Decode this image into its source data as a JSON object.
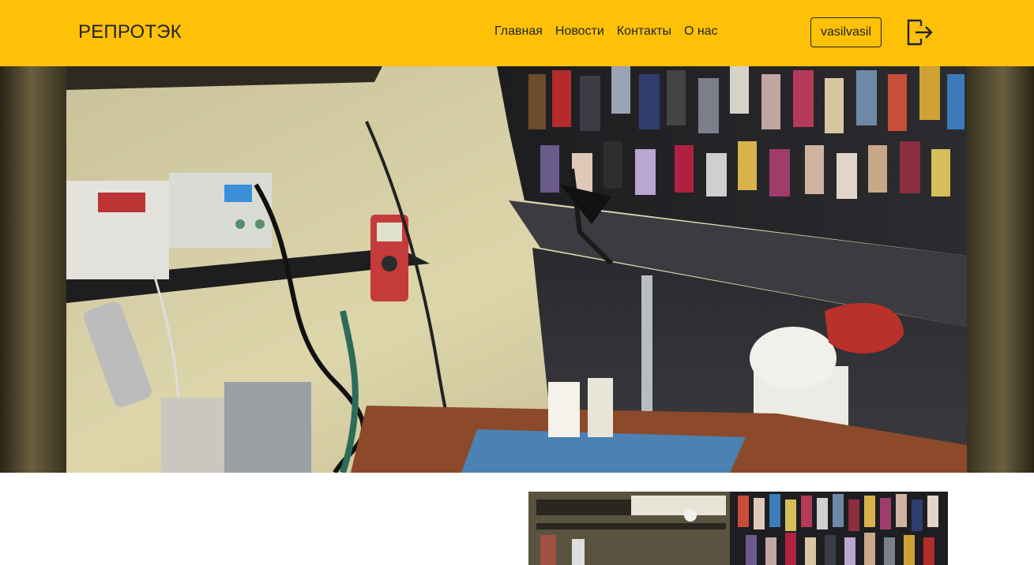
{
  "header": {
    "brand": "РЕПРОТЭК",
    "nav": [
      {
        "label": "Главная"
      },
      {
        "label": "Новости"
      },
      {
        "label": "Контакты"
      },
      {
        "label": "О нас"
      }
    ],
    "user_label": "vasilvasil",
    "logout_icon": "logout-icon"
  },
  "colors": {
    "navbar": "#ffc107",
    "text": "#212529"
  },
  "carousel": {
    "image": "repair-workshop-photo"
  },
  "content": {
    "image": "phone-accessories-shop-photo"
  }
}
